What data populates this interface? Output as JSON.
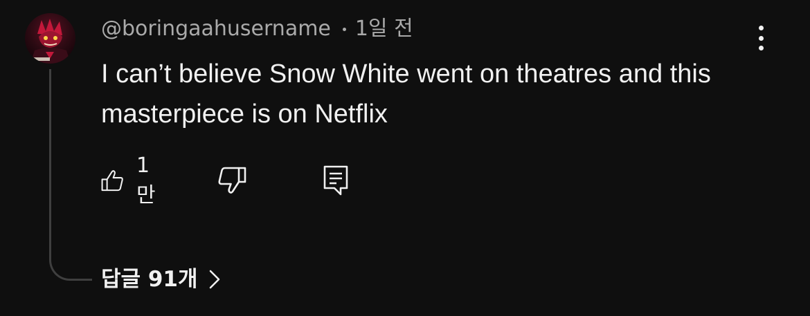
{
  "comment": {
    "author": "@boringaahusername",
    "timestamp": "1일 전",
    "text": "I can’t believe Snow White went on theatres and this masterpiece is on Netflix",
    "avatar": "profile-picture",
    "actions": {
      "like_icon": "thumbs-up-icon",
      "like_count": "1만",
      "dislike_icon": "thumbs-down-icon",
      "reply_icon": "comment-reply-icon"
    },
    "more_options_icon": "vertical-ellipsis-icon",
    "replies": {
      "label": "답글 91개",
      "icon": "chevron-right-icon"
    }
  },
  "colors": {
    "background": "#0f0f0f",
    "primary_text": "#f1f1f1",
    "secondary_text": "#aaaaaa",
    "thread_line": "#3f3f3f",
    "avatar_accent": "#c2183a"
  }
}
